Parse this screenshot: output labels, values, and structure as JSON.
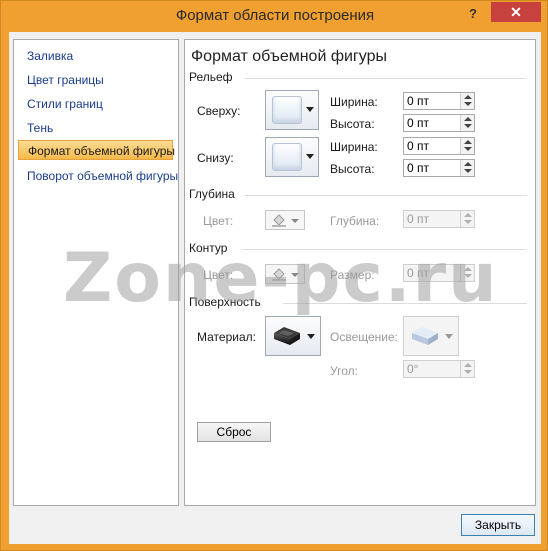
{
  "window": {
    "title": "Формат области построения",
    "help_label": "?",
    "close_label": "✕"
  },
  "sidebar": {
    "items": [
      {
        "label": "Заливка"
      },
      {
        "label": "Цвет границы"
      },
      {
        "label": "Стили границ"
      },
      {
        "label": "Тень"
      },
      {
        "label": "Формат объемной фигуры",
        "selected": true
      },
      {
        "label": "Поворот объемной фигуры"
      }
    ]
  },
  "main": {
    "title": "Формат объемной фигуры",
    "relief": {
      "section": "Рельеф",
      "top_label": "Сверху:",
      "bottom_label": "Снизу:",
      "top_width_label": "Ширина:",
      "top_width_value": "0 пт",
      "top_height_label": "Высота:",
      "top_height_value": "0 пт",
      "bottom_width_label": "Ширина:",
      "bottom_width_value": "0 пт",
      "bottom_height_label": "Высота:",
      "bottom_height_value": "0 пт"
    },
    "depth": {
      "section": "Глубина",
      "color_label": "Цвет:",
      "depth_label": "Глубина:",
      "depth_value": "0 пт"
    },
    "contour": {
      "section": "Контур",
      "color_label": "Цвет:",
      "size_label": "Размер:",
      "size_value": "0 пт"
    },
    "surface": {
      "section": "Поверхность",
      "material_label": "Материал:",
      "lighting_label": "Освещение:",
      "angle_label": "Угол:",
      "angle_value": "0°"
    },
    "reset_label": "Сброс"
  },
  "footer": {
    "close_label": "Закрыть"
  },
  "watermark": "Zone-pc.ru",
  "colors": {
    "frame": "#f0a030",
    "close_button": "#c7413f",
    "selected_item": "#f5b94c",
    "link_text": "#1a3c8c"
  }
}
